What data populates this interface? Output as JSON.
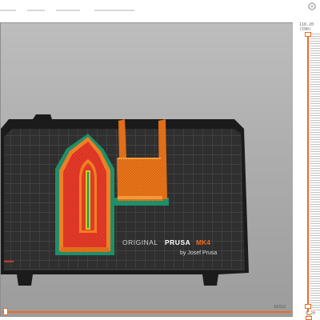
{
  "viewport": {
    "logo_line1": "ORIGINAL",
    "logo_line2": "PRUSA",
    "logo_line3": "MK4",
    "logo_sub": "by Josef Prusa",
    "colors": {
      "bed": "#2b2b2b",
      "grid": "#5e5e5e",
      "perimeter": "#ed6b21",
      "infill": "#e53b2a",
      "skirt": "#1f8f6a",
      "solid_infill": "#c9d01c"
    }
  },
  "layer_slider": {
    "top_value": "118.20",
    "top_layer": "(590)",
    "bottom_value": "0.20",
    "bottom_layer": "(1)",
    "accent": "#ed6b21"
  },
  "horizontal_slider": {
    "value": "16322"
  },
  "icons": {
    "settings": "cog-icon",
    "lock": "lock-icon"
  }
}
